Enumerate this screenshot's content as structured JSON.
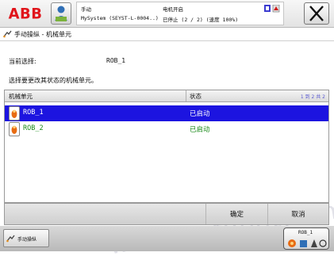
{
  "header": {
    "logo_text": "ABB",
    "mode": "手动",
    "system": "MySystem (SEYST-L-0004..)",
    "motor": "电机开启",
    "state": "已停止 (2 / 2) (速度 100%)"
  },
  "window": {
    "title": "手动操纵 - 机械单元"
  },
  "main": {
    "current_label": "当前选择:",
    "current_value": "ROB_1",
    "instruction": "选择要更改其状态的机械单元。",
    "table": {
      "headers": [
        "机械单元",
        "状态"
      ],
      "page_info": "1 到 2 共 2",
      "rows": [
        {
          "name": "ROB_1",
          "state": "已启动",
          "selected": true
        },
        {
          "name": "ROB_2",
          "state": "已启动",
          "selected": false
        }
      ]
    }
  },
  "actions": {
    "ok_label": "确定",
    "cancel_label": "取消"
  },
  "taskbar": {
    "task_label": "手动操纵",
    "quickset_label": "ROB_1"
  },
  "watermark": "www.zr-robot.com",
  "colors": {
    "selected_row": "#1c14e0",
    "enabled_text": "#1a8a1a",
    "logo_red": "#e0151b"
  },
  "icons": [
    "user-icon",
    "close-icon",
    "jog-icon",
    "robot-icon"
  ]
}
